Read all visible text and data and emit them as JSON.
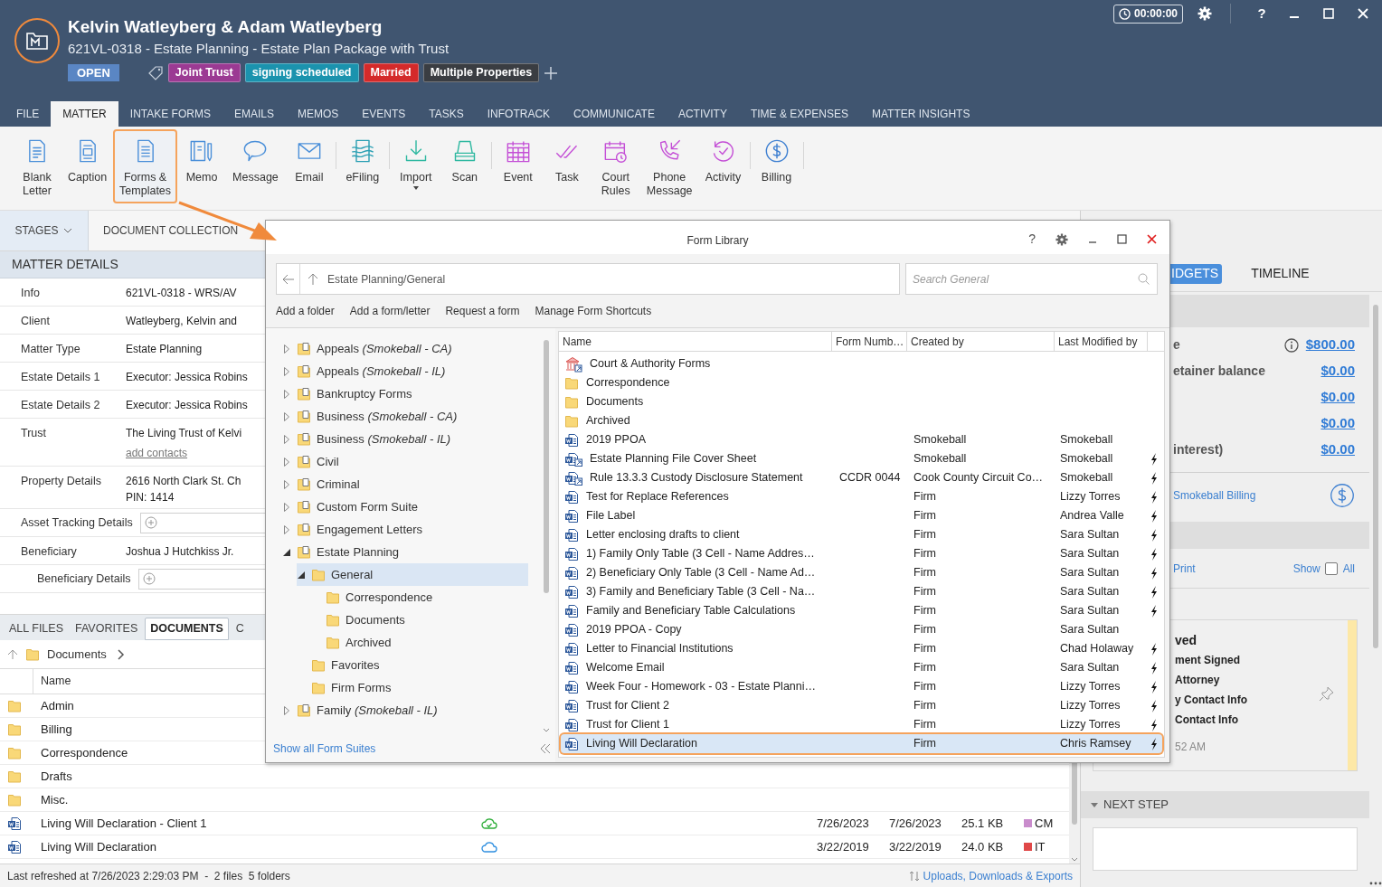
{
  "window": {
    "title": "Kelvin Watleyberg & Adam Watleyberg",
    "subtitle": "621VL-0318 - Estate Planning - Estate Plan Package with Trust",
    "status": "OPEN",
    "timer": "00:00:00",
    "help": "?",
    "tags": [
      {
        "label": "Joint Trust",
        "color": "#9b3a93"
      },
      {
        "label": "signing scheduled",
        "color": "#1b93ae"
      },
      {
        "label": "Married",
        "color": "#d42a2a"
      },
      {
        "label": "Multiple Properties",
        "color": "#3a3d42"
      }
    ]
  },
  "tabs": [
    {
      "label": "FILE",
      "selected": false
    },
    {
      "label": "MATTER",
      "selected": true
    },
    {
      "label": "INTAKE FORMS",
      "selected": false
    },
    {
      "label": "EMAILS",
      "selected": false
    },
    {
      "label": "MEMOS",
      "selected": false
    },
    {
      "label": "EVENTS",
      "selected": false
    },
    {
      "label": "TASKS",
      "selected": false
    },
    {
      "label": "INFOTRACK",
      "selected": false
    },
    {
      "label": "COMMUNICATE",
      "selected": false
    },
    {
      "label": "ACTIVITY",
      "selected": false
    },
    {
      "label": "TIME & EXPENSES",
      "selected": false
    },
    {
      "label": "MATTER INSIGHTS",
      "selected": false
    }
  ],
  "ribbon": {
    "groups": [
      [
        {
          "lines": [
            "Blank",
            "Letter"
          ],
          "highlighted": false,
          "dropdown": false
        },
        {
          "lines": [
            "Caption"
          ],
          "highlighted": false,
          "dropdown": false
        },
        {
          "lines": [
            "Forms &",
            "Templates"
          ],
          "highlighted": true,
          "dropdown": false
        },
        {
          "lines": [
            "Memo"
          ],
          "highlighted": false,
          "dropdown": false
        },
        {
          "lines": [
            "Message"
          ],
          "highlighted": false,
          "dropdown": false
        },
        {
          "lines": [
            "Email"
          ],
          "highlighted": false,
          "dropdown": false
        }
      ],
      [
        {
          "lines": [
            "eFiling"
          ],
          "highlighted": false,
          "dropdown": false
        }
      ],
      [
        {
          "lines": [
            "Import"
          ],
          "highlighted": false,
          "dropdown": true
        },
        {
          "lines": [
            "Scan"
          ],
          "highlighted": false,
          "dropdown": false
        }
      ],
      [
        {
          "lines": [
            "Event"
          ],
          "highlighted": false,
          "dropdown": false
        },
        {
          "lines": [
            "Task"
          ],
          "highlighted": false,
          "dropdown": false
        },
        {
          "lines": [
            "Court",
            "Rules"
          ],
          "highlighted": false,
          "dropdown": false
        },
        {
          "lines": [
            "Phone",
            "Message"
          ],
          "highlighted": false,
          "dropdown": false
        },
        {
          "lines": [
            "Activity"
          ],
          "highlighted": false,
          "dropdown": false
        }
      ],
      [
        {
          "lines": [
            "Billing"
          ],
          "highlighted": false,
          "dropdown": false
        }
      ]
    ]
  },
  "stages": {
    "label": "STAGES",
    "current": "DOCUMENT COLLECTION"
  },
  "matter_details": {
    "title": "MATTER DETAILS",
    "fields": [
      {
        "kind": "text",
        "label": "Info",
        "value": "621VL-0318 - WRS/AV"
      },
      {
        "kind": "text",
        "label": "Client",
        "value": "Watleyberg, Kelvin and"
      },
      {
        "kind": "text",
        "label": "Matter Type",
        "value": "Estate Planning"
      },
      {
        "kind": "text",
        "label": "Estate Details 1",
        "value": "Executor: Jessica Robins"
      },
      {
        "kind": "text",
        "label": "Estate Details 2",
        "value": "Executor: Jessica Robins"
      },
      {
        "kind": "text",
        "label": "Trust",
        "value": "The Living Trust of Kelvi",
        "link": "add contacts"
      },
      {
        "kind": "text",
        "label": "Property Details",
        "value": "2616 North Clark St. Ch",
        "value_2": "PIN: 1414"
      },
      {
        "kind": "add",
        "label": "Asset Tracking Details"
      },
      {
        "kind": "text",
        "label": "Beneficiary",
        "value": "Joshua J Hutchkiss Jr.",
        "children": [
          {
            "kind": "add",
            "label": "Beneficiary Details"
          }
        ]
      }
    ]
  },
  "files": {
    "tabs": [
      {
        "label": "ALL FILES",
        "selected": false
      },
      {
        "label": "FAVORITES",
        "selected": false
      },
      {
        "label": "DOCUMENTS",
        "selected": true
      },
      {
        "label": "C",
        "selected": false
      }
    ],
    "breadcrumb": "Documents",
    "columns": [
      "Name"
    ],
    "rows": [
      {
        "kind": "folder",
        "name": "Admin"
      },
      {
        "kind": "folder",
        "name": "Billing"
      },
      {
        "kind": "folder",
        "name": "Correspondence"
      },
      {
        "kind": "folder",
        "name": "Drafts"
      },
      {
        "kind": "folder",
        "name": "Misc."
      },
      {
        "kind": "document",
        "name": "Living Will Declaration - Client 1",
        "synced": true,
        "created": "7/26/2023",
        "modified": "7/26/2023",
        "size": "25.1 KB",
        "tag": {
          "label": "CM",
          "color": "#c98ccc"
        }
      },
      {
        "kind": "document",
        "name": "Living Will Declaration",
        "synced": false,
        "created": "3/22/2019",
        "modified": "3/22/2019",
        "size": "24.0 KB",
        "tag": {
          "label": "IT",
          "color": "#e04848"
        }
      }
    ],
    "status": "Last refreshed at 7/26/2023 2:29:03 PM  -  2 files  5 folders",
    "transfers_link": "Uploads, Downloads & Exports"
  },
  "form_library": {
    "title": "Form Library",
    "help": "?",
    "path": "Estate Planning/General",
    "search_placeholder": "Search General",
    "actions": [
      "Add a folder",
      "Add a form/letter",
      "Request a form",
      "Manage Form Shortcuts"
    ],
    "tree": [
      {
        "name": "Appeals *(Smokeball - CA)*",
        "kind": "suite",
        "expanded": false,
        "selected": false
      },
      {
        "name": "Appeals *(Smokeball - IL)*",
        "kind": "suite",
        "expanded": false,
        "selected": false
      },
      {
        "name": "Bankruptcy Forms",
        "kind": "suite",
        "expanded": false,
        "selected": false
      },
      {
        "name": "Business *(Smokeball - CA)*",
        "kind": "suite",
        "expanded": false,
        "selected": false
      },
      {
        "name": "Business *(Smokeball - IL)*",
        "kind": "suite",
        "expanded": false,
        "selected": false
      },
      {
        "name": "Civil",
        "kind": "suite",
        "expanded": false,
        "selected": false
      },
      {
        "name": "Criminal",
        "kind": "suite",
        "expanded": false,
        "selected": false
      },
      {
        "name": "Custom Form Suite",
        "kind": "suite",
        "expanded": false,
        "selected": false
      },
      {
        "name": "Engagement Letters",
        "kind": "suite",
        "expanded": false,
        "selected": false
      },
      {
        "name": "Estate Planning",
        "kind": "suite",
        "expanded": true,
        "selected": false,
        "children": [
          {
            "name": "General",
            "kind": "folder",
            "expanded": true,
            "selected": true,
            "children": [
              {
                "name": "Correspondence",
                "kind": "folder",
                "selected": false
              },
              {
                "name": "Documents",
                "kind": "folder",
                "selected": false
              },
              {
                "name": "Archived",
                "kind": "folder",
                "selected": false
              }
            ]
          },
          {
            "name": "Favorites",
            "kind": "folder",
            "selected": false
          },
          {
            "name": "Firm Forms",
            "kind": "folder",
            "selected": false
          }
        ]
      },
      {
        "name": "Family *(Smokeball - IL)*",
        "kind": "suite",
        "expanded": false,
        "selected": false
      }
    ],
    "columns": [
      "Name",
      "Form Numb…",
      "Created by",
      "Last Modified by"
    ],
    "rows": [
      {
        "kind": "court",
        "name": "Court & Authority Forms",
        "flash": false,
        "selected": false
      },
      {
        "kind": "folder",
        "name": "Correspondence",
        "flash": false,
        "selected": false
      },
      {
        "kind": "folder",
        "name": "Documents",
        "flash": false,
        "selected": false
      },
      {
        "kind": "folder",
        "name": "Archived",
        "flash": false,
        "selected": false
      },
      {
        "kind": "document",
        "name": "2019 PPOA",
        "created_by": "Smokeball",
        "modified_by": "Smokeball",
        "flash": false,
        "selected": false
      },
      {
        "kind": "shortcut",
        "name": "Estate Planning File Cover Sheet",
        "created_by": "Smokeball",
        "modified_by": "Smokeball",
        "flash": true,
        "selected": false
      },
      {
        "kind": "shortcut",
        "name": "Rule 13.3.3 Custody Disclosure Statement",
        "form_number": "CCDR 0044",
        "created_by": "Cook County Circuit Co…",
        "modified_by": "Smokeball",
        "flash": true,
        "selected": false
      },
      {
        "kind": "document",
        "name": "Test for Replace References",
        "created_by": "Firm",
        "modified_by": "Lizzy Torres",
        "flash": true,
        "selected": false
      },
      {
        "kind": "document",
        "name": "File Label",
        "created_by": "Firm",
        "modified_by": "Andrea Valle",
        "flash": true,
        "selected": false
      },
      {
        "kind": "document",
        "name": "Letter enclosing drafts to client",
        "created_by": "Firm",
        "modified_by": "Sara Sultan",
        "flash": true,
        "selected": false
      },
      {
        "kind": "document",
        "name": "1) Family Only Table (3 Cell - Name Addres…",
        "created_by": "Firm",
        "modified_by": "Sara Sultan",
        "flash": true,
        "selected": false
      },
      {
        "kind": "document",
        "name": "2) Beneficiary Only Table (3 Cell - Name Ad…",
        "created_by": "Firm",
        "modified_by": "Sara Sultan",
        "flash": true,
        "selected": false
      },
      {
        "kind": "document",
        "name": "3) Family and Beneficiary Table (3 Cell - Na…",
        "created_by": "Firm",
        "modified_by": "Sara Sultan",
        "flash": true,
        "selected": false
      },
      {
        "kind": "document",
        "name": "Family and Beneficiary Table Calculations",
        "created_by": "Firm",
        "modified_by": "Sara Sultan",
        "flash": true,
        "selected": false
      },
      {
        "kind": "document",
        "name": "2019 PPOA - Copy",
        "created_by": "Firm",
        "modified_by": "Sara Sultan",
        "flash": false,
        "selected": false
      },
      {
        "kind": "document",
        "name": "Letter to Financial Institutions",
        "created_by": "Firm",
        "modified_by": "Chad Holaway",
        "flash": true,
        "selected": false
      },
      {
        "kind": "document",
        "name": "Welcome Email",
        "created_by": "Firm",
        "modified_by": "Sara Sultan",
        "flash": true,
        "selected": false
      },
      {
        "kind": "document",
        "name": "Week Four - Homework - 03 - Estate Planni…",
        "created_by": "Firm",
        "modified_by": "Lizzy Torres",
        "flash": true,
        "selected": false
      },
      {
        "kind": "document",
        "name": "Trust for Client 2",
        "created_by": "Firm",
        "modified_by": "Lizzy Torres",
        "flash": true,
        "selected": false
      },
      {
        "kind": "document",
        "name": "Trust for Client 1",
        "created_by": "Firm",
        "modified_by": "Lizzy Torres",
        "flash": true,
        "selected": false
      },
      {
        "kind": "document",
        "name": "Living Will Declaration",
        "created_by": "Firm",
        "modified_by": "Chris Ramsey",
        "flash": true,
        "selected": true
      }
    ],
    "footer_link": "Show all Form Suites"
  },
  "right_panel": {
    "tabs": [
      {
        "label": "IDGETS",
        "selected": true
      },
      {
        "label": "TIMELINE",
        "selected": false
      }
    ],
    "billing": [
      {
        "label": "e",
        "amount": "$800.00",
        "info": true
      },
      {
        "label": "etainer balance",
        "amount": "$0.00",
        "info": false
      },
      {
        "amount": "$0.00",
        "info": false
      },
      {
        "amount": "$0.00",
        "info": false
      },
      {
        "label": "interest)",
        "amount": "$0.00",
        "info": false
      }
    ],
    "billing_link": "Smokeball Billing",
    "print_link": "Print",
    "show_label": "Show",
    "all_label": "All",
    "show_all_checked": false,
    "note": {
      "title": "ved",
      "lines": [
        "ment Signed",
        "Attorney",
        "y Contact Info",
        "Contact Info"
      ],
      "time": "52 AM"
    },
    "next_step": {
      "title": "NEXT STEP"
    }
  }
}
